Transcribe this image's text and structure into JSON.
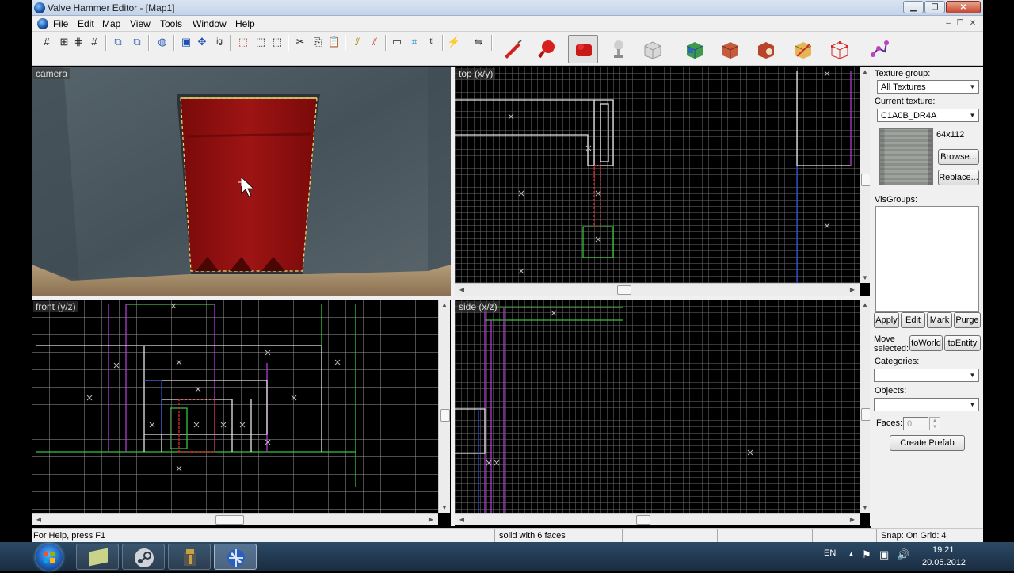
{
  "window": {
    "title": "Valve Hammer Editor - [Map1]"
  },
  "menu": {
    "items": [
      "File",
      "Edit",
      "Map",
      "View",
      "Tools",
      "Window",
      "Help"
    ]
  },
  "toolbar": {
    "left_buttons": [
      "grid-icon",
      "grid-smaller-icon",
      "grid-larger-icon",
      "grid-dots-icon",
      "group-icon",
      "ungroup-icon",
      "carve-icon",
      "select-icon",
      "texture-lock-icon",
      "ignore-groups-icon",
      "hide-icon",
      "show-icon",
      "quick-hide-icon",
      "cut-icon",
      "copy-icon",
      "paste-icon",
      "snap-icon",
      "snap-alt-icon",
      "box-icon",
      "crop-icon",
      "tl-icon",
      "vertex-icon",
      "flip-icon"
    ],
    "tools": [
      "selection-tool-icon",
      "magnify-tool-icon",
      "camera-tool-icon",
      "entity-tool-icon",
      "block-tool-icon",
      "texture-tool-icon",
      "apply-texture-icon",
      "decal-tool-icon",
      "clip-tool-icon",
      "vertex-tool-icon",
      "path-tool-icon"
    ],
    "active_tool": "camera-tool-icon"
  },
  "viewports": {
    "camera": {
      "label": "camera"
    },
    "top": {
      "label": "top (x/y)"
    },
    "front": {
      "label": "front (y/z)"
    },
    "side": {
      "label": "side (x/z)"
    }
  },
  "panel": {
    "texture_group_label": "Texture group:",
    "texture_group_value": "All Textures",
    "current_texture_label": "Current texture:",
    "current_texture_value": "C1A0B_DR4A",
    "texture_size": "64x112",
    "browse": "Browse...",
    "replace": "Replace...",
    "visgroups_label": "VisGroups:",
    "apply": "Apply",
    "edit": "Edit",
    "mark": "Mark",
    "purge": "Purge",
    "move_selected": "Move selected:",
    "to_world": "toWorld",
    "to_entity": "toEntity",
    "categories_label": "Categories:",
    "objects_label": "Objects:",
    "faces_label": "Faces:",
    "faces_value": "0",
    "create_prefab": "Create Prefab"
  },
  "status": {
    "help": "For Help, press F1",
    "selection": "solid with 6 faces",
    "snap": "Snap: On Grid: 4"
  },
  "taskbar": {
    "lang": "EN",
    "time": "19:21",
    "date": "20.05.2012",
    "tasks": [
      "notepad-icon",
      "steam-icon",
      "hammer-app-icon",
      "hammer-editor-icon"
    ]
  },
  "colors": {
    "door": "#8e0e0e",
    "wall": "#4b5962",
    "floor": "#9c8464",
    "grid_green": "#34c43c",
    "grid_purple": "#b03cd0"
  }
}
